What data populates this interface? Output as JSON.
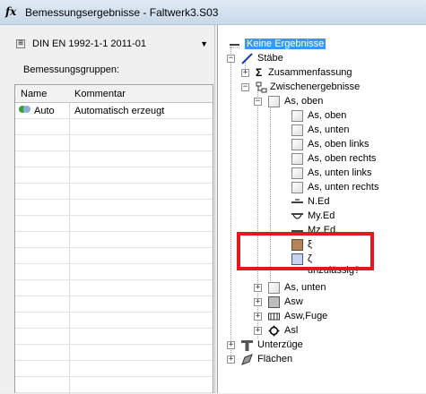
{
  "window": {
    "title": "Bemessungsergebnisse - Faltwerk3.S03",
    "title_icon": "fx",
    "background_ghost_lines": [
      "",
      "",
      ""
    ]
  },
  "left_pane": {
    "norm_select": {
      "value": "DIN EN 1992-1-1 2011-01",
      "icon": "norm-icon",
      "arrow": "▼"
    },
    "groups_label": "Bemessungsgruppen:",
    "table": {
      "columns": [
        "Name",
        "Kommentar"
      ],
      "rows": [
        {
          "name": "Auto",
          "comment": "Automatisch erzeugt",
          "status_colors": [
            "#3aa13a",
            "#8ab0d8"
          ]
        }
      ]
    }
  },
  "tree": {
    "root": "Keine Ergebnisse",
    "staebe": "Stäbe",
    "zusammenfassung": "Zusammenfassung",
    "zwischenergebnisse": "Zwischenergebnisse",
    "as_oben_group": "As, oben",
    "items": [
      "As, oben",
      "As, unten",
      "As, oben links",
      "As, oben rechts",
      "As, unten links",
      "As, unten rechts",
      "N.Ed",
      "My.Ed",
      "Mz.Ed",
      "ξ",
      "ζ",
      "unzulässig?"
    ],
    "as_unten_group": "As, unten",
    "asw": "Asw",
    "asw_fuge": "Asw,Fuge",
    "asl": "Asl",
    "unterzuege": "Unterzüge",
    "flaechen": "Flächen",
    "expand_plus": "+",
    "expand_minus": "−",
    "sigma_symbol": "Σ",
    "highlight_color": "#e0191f"
  }
}
